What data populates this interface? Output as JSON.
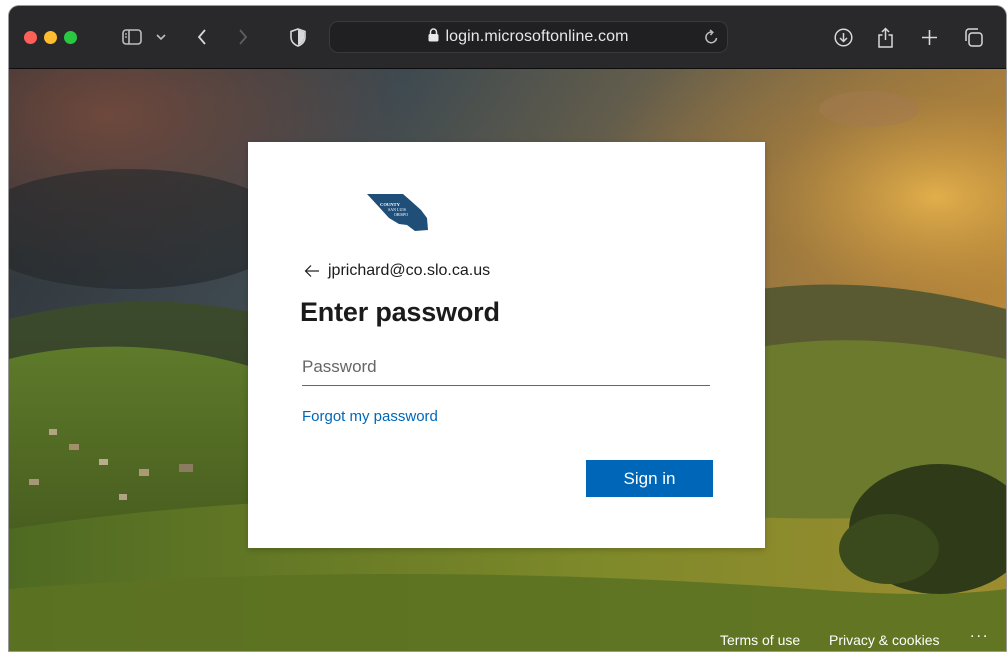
{
  "browser": {
    "url": "login.microsoftonline.com",
    "icons": {
      "close": "close-dot",
      "minimize": "minimize-dot",
      "zoom": "zoom-dot",
      "sidebar": "sidebar-icon",
      "chevron": "chevron-down-icon",
      "back": "chevron-left-icon",
      "forward": "chevron-right-icon",
      "privacy": "shield-icon",
      "lock": "lock-icon",
      "reload": "reload-icon",
      "downloads": "download-icon",
      "share": "share-icon",
      "new_tab": "plus-icon",
      "tabs": "tab-overview-icon"
    },
    "colors": {
      "close": "#fe5f57",
      "minimize": "#febc2e",
      "zoom": "#28c840"
    }
  },
  "signin": {
    "logo_text": "COUNTY OF SAN LUIS OBISPO",
    "account": "jprichard@co.slo.ca.us",
    "title": "Enter password",
    "password_placeholder": "Password",
    "forgot_label": "Forgot my password",
    "submit_label": "Sign in",
    "accent": "#0067b8"
  },
  "footer": {
    "terms": "Terms of use",
    "privacy": "Privacy & cookies",
    "more": "..."
  }
}
